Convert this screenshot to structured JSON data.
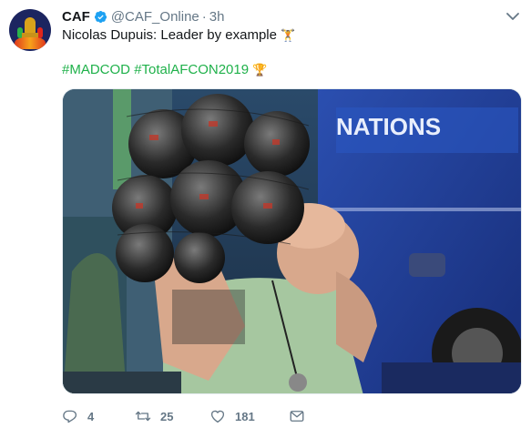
{
  "tweet": {
    "author_name": "CAF",
    "author_handle": "@CAF_Online",
    "separator": "·",
    "timestamp": "3h",
    "text": "Nicolas Dupuis: Leader by example",
    "text_emoji": "🏋",
    "hashtags": [
      "#MADCOD",
      "#TotalAFCON2019"
    ],
    "hashtags_emoji": "🏆",
    "media_banner_text": "NATIONS",
    "actions": {
      "reply_count": "4",
      "retweet_count": "25",
      "like_count": "181"
    }
  },
  "icons": {
    "verified": "verified-badge-icon",
    "menu": "chevron-down-icon",
    "reply": "reply-icon",
    "retweet": "retweet-icon",
    "like": "heart-icon",
    "dm": "envelope-icon"
  },
  "colors": {
    "hashtag": "#1fb14a",
    "verified": "#1da1f2",
    "muted": "#657786",
    "text": "#14171a",
    "bus": "#1f3a8a"
  }
}
